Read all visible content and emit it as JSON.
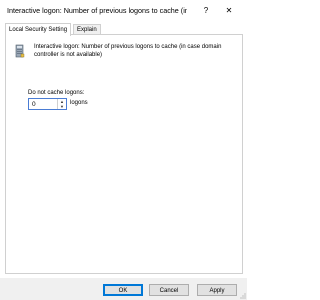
{
  "window": {
    "title": "Interactive logon: Number of previous logons to cache (in...",
    "help_glyph": "?",
    "close_glyph": "✕"
  },
  "tabs": [
    {
      "label": "Local Security Setting",
      "active": true
    },
    {
      "label": "Explain",
      "active": false
    }
  ],
  "policy": {
    "icon": "policy-server-icon",
    "description": "Interactive logon: Number of previous logons to cache (in case domain controller is not available)"
  },
  "setting": {
    "label": "Do not cache logons:",
    "value": "0",
    "unit": "logons"
  },
  "buttons": {
    "ok": "OK",
    "cancel": "Cancel",
    "apply": "Apply"
  },
  "colors": {
    "accent": "#0078d7",
    "background": "#ffffff",
    "footer": "#f0f0f0"
  }
}
